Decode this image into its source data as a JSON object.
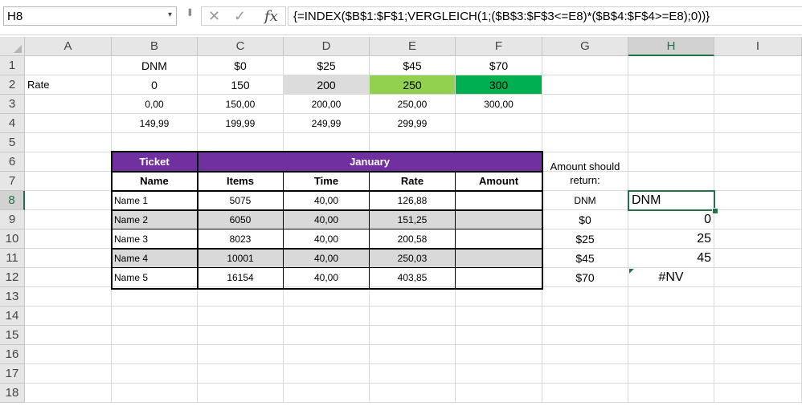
{
  "formula_bar": {
    "name_box": "H8",
    "name_box_arrow": "▾",
    "cancel_icon": "✕",
    "enter_icon": "✓",
    "fx_icon": "fx",
    "formula": "{=INDEX($B$1:$F$1;VERGLEICH(1;($B$3:$F$3<=E8)*($B$4:$F$4>=E8);0))}"
  },
  "columns": [
    "A",
    "B",
    "C",
    "D",
    "E",
    "F",
    "G",
    "H",
    "I"
  ],
  "rows": [
    "1",
    "2",
    "3",
    "4",
    "5",
    "6",
    "7",
    "8",
    "9",
    "10",
    "11",
    "12",
    "13",
    "14",
    "15",
    "16",
    "17",
    "18"
  ],
  "selected": {
    "column": "H",
    "row": "8"
  },
  "cells": {
    "B1": "DNM",
    "C1": "$0",
    "D1": "$25",
    "E1": "$45",
    "F1": "$70",
    "A2": "Rate",
    "B2": "0",
    "C2": "150",
    "D2": "200",
    "E2": "250",
    "F2": "300",
    "B3": "0,00",
    "C3": "150,00",
    "D3": "200,00",
    "E3": "250,00",
    "F3": "300,00",
    "B4": "149,99",
    "C4": "199,99",
    "D4": "249,99",
    "E4": "299,99",
    "B6": "Ticket",
    "C6": "January",
    "B7": "Name",
    "C7": "Items",
    "D7": "Time",
    "E7": "Rate",
    "F7": "Amount",
    "G6": "Amount should return:",
    "B8": "Name 1",
    "C8": "5075",
    "D8": "40,00",
    "E8": "126,88",
    "B9": "Name 2",
    "C9": "6050",
    "D9": "40,00",
    "E9": "151,25",
    "B10": "Name 3",
    "C10": "8023",
    "D10": "40,00",
    "E10": "200,58",
    "B11": "Name 4",
    "C11": "10001",
    "D11": "40,00",
    "E11": "250,03",
    "B12": "Name 5",
    "C12": "16154",
    "D12": "40,00",
    "E12": "403,85",
    "G8": "DNM",
    "G9": "$0",
    "G10": "$25",
    "G11": "$45",
    "G12": "$70",
    "H8": "DNM",
    "H9": "0",
    "H10": "25",
    "H11": "45",
    "H12": "#NV"
  },
  "colors": {
    "header_purple": "#7030a0",
    "light_green": "#92d050",
    "green": "#00b050",
    "grey": "#d9d9d9",
    "selection_green": "#217346"
  }
}
